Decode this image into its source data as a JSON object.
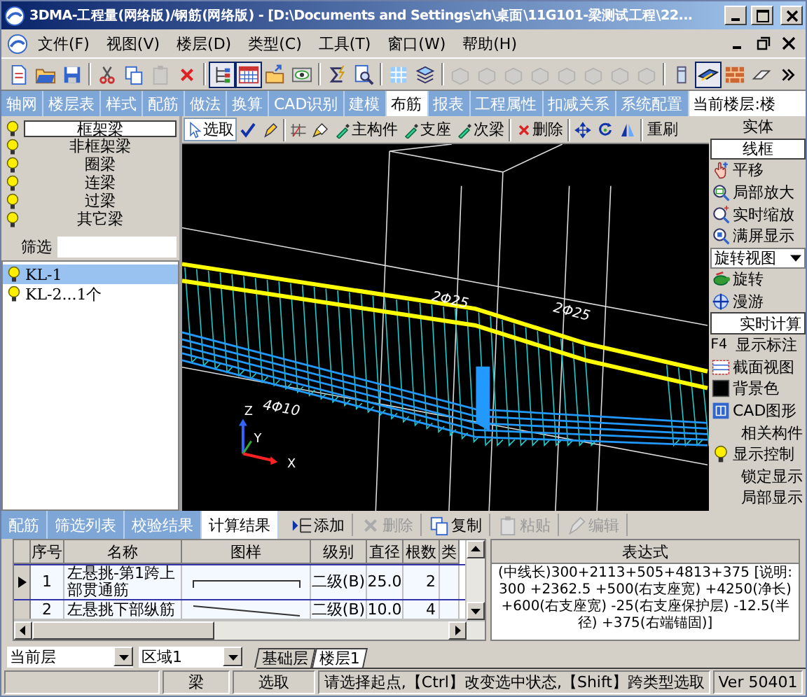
{
  "window": {
    "title": "3DMA-工程量(网络版)/钢筋(网络版) - [D:\\Documents and Settings\\zh\\桌面\\11G101-梁测试工程\\22..."
  },
  "menu": [
    "文件(F)",
    "视图(V)",
    "楼层(D)",
    "类型(C)",
    "工具(T)",
    "窗口(W)",
    "帮助(H)"
  ],
  "toolbar": [
    {
      "kind": "new",
      "disabled": false,
      "pressed": false
    },
    {
      "kind": "open",
      "disabled": false,
      "pressed": false
    },
    {
      "kind": "save",
      "disabled": false,
      "pressed": false
    },
    {
      "kind": "sep"
    },
    {
      "kind": "cut",
      "disabled": false,
      "pressed": false
    },
    {
      "kind": "copy",
      "disabled": false,
      "pressed": false
    },
    {
      "kind": "paste",
      "disabled": true,
      "pressed": false
    },
    {
      "kind": "delete",
      "disabled": false,
      "pressed": false
    },
    {
      "kind": "sep"
    },
    {
      "kind": "tree",
      "disabled": false,
      "pressed": true
    },
    {
      "kind": "table",
      "disabled": false,
      "pressed": true
    },
    {
      "kind": "export",
      "disabled": false,
      "pressed": false
    },
    {
      "kind": "view",
      "disabled": false,
      "pressed": false
    },
    {
      "kind": "sep"
    },
    {
      "kind": "sum",
      "disabled": false,
      "pressed": false
    },
    {
      "kind": "query",
      "disabled": false,
      "pressed": false
    },
    {
      "kind": "sep"
    },
    {
      "kind": "grid",
      "disabled": false,
      "pressed": false
    },
    {
      "kind": "layers",
      "disabled": false,
      "pressed": false
    },
    {
      "kind": "sep"
    },
    {
      "kind": "part",
      "disabled": true,
      "pressed": false
    },
    {
      "kind": "part",
      "disabled": true,
      "pressed": false
    },
    {
      "kind": "part",
      "disabled": true,
      "pressed": false
    },
    {
      "kind": "part",
      "disabled": true,
      "pressed": false
    },
    {
      "kind": "part",
      "disabled": true,
      "pressed": false
    },
    {
      "kind": "part",
      "disabled": true,
      "pressed": false
    },
    {
      "kind": "part",
      "disabled": true,
      "pressed": false
    },
    {
      "kind": "part",
      "disabled": true,
      "pressed": false
    },
    {
      "kind": "sep"
    },
    {
      "kind": "column",
      "disabled": false,
      "pressed": false
    },
    {
      "kind": "beam",
      "disabled": false,
      "pressed": true
    },
    {
      "kind": "brick",
      "disabled": false,
      "pressed": false
    },
    {
      "kind": "eraser",
      "disabled": false,
      "pressed": false
    },
    {
      "kind": "more",
      "disabled": false,
      "pressed": false
    }
  ],
  "module_tabs": [
    {
      "label": "轴网",
      "selected": false
    },
    {
      "label": "楼层表",
      "selected": false
    },
    {
      "label": "样式",
      "selected": false
    },
    {
      "label": "配筋",
      "selected": false
    },
    {
      "label": "做法",
      "selected": false
    },
    {
      "label": "换算",
      "selected": false
    },
    {
      "label": "CAD识别",
      "selected": false
    },
    {
      "label": "建模",
      "selected": false
    },
    {
      "label": "布筋",
      "selected": true
    },
    {
      "label": "报表",
      "selected": false
    },
    {
      "label": "工程属性",
      "selected": false
    },
    {
      "label": "扣减关系",
      "selected": false
    },
    {
      "label": "系统配置",
      "selected": false
    }
  ],
  "current_floor": "当前楼层:楼",
  "beam_types": [
    {
      "label": "框架梁",
      "selected": true
    },
    {
      "label": "非框架梁",
      "selected": false
    },
    {
      "label": "圈梁",
      "selected": false
    },
    {
      "label": "连梁",
      "selected": false
    },
    {
      "label": "过梁",
      "selected": false
    },
    {
      "label": "其它梁",
      "selected": false
    }
  ],
  "filter": {
    "label": "筛选"
  },
  "components": [
    {
      "label": "KL-1",
      "selected": true
    },
    {
      "label": "KL-2...1个",
      "selected": false
    }
  ],
  "draw_tools": [
    {
      "kind": "select",
      "label": "选取",
      "selected": true
    },
    {
      "kind": "check",
      "selected": false
    },
    {
      "kind": "pen",
      "selected": false
    },
    {
      "kind": "sep"
    },
    {
      "kind": "frame",
      "selected": false
    },
    {
      "kind": "brush",
      "selected": false
    },
    {
      "kind": "dropper",
      "label": "主构件",
      "selected": false
    },
    {
      "kind": "dropper",
      "label": "支座",
      "selected": false
    },
    {
      "kind": "dropper",
      "label": "次梁",
      "selected": false
    },
    {
      "kind": "sep"
    },
    {
      "kind": "delete",
      "label": "删除",
      "selected": false
    },
    {
      "kind": "sep"
    },
    {
      "kind": "move",
      "selected": false
    },
    {
      "kind": "rotate",
      "selected": false
    },
    {
      "kind": "mirror",
      "selected": false
    },
    {
      "kind": "sep"
    },
    {
      "kind": "plain",
      "label": "重刷",
      "selected": false
    }
  ],
  "viewport": {
    "labels": [
      "2Φ25",
      "2Φ25",
      "4Φ10"
    ],
    "axes": [
      "Z",
      "Y",
      "X"
    ]
  },
  "view_panel": [
    {
      "kind": "mode",
      "label": "实体",
      "selected": false
    },
    {
      "kind": "mode",
      "label": "线框",
      "selected": true
    },
    {
      "kind": "pan",
      "label": "平移"
    },
    {
      "kind": "zoombox",
      "label": "局部放大"
    },
    {
      "kind": "zoom",
      "label": "实时缩放"
    },
    {
      "kind": "fit",
      "label": "满屏显示"
    },
    {
      "kind": "dropdown",
      "label": "旋转视图"
    },
    {
      "kind": "rotate",
      "label": "旋转"
    },
    {
      "kind": "walk",
      "label": "漫游"
    },
    {
      "kind": "box",
      "label": "实时计算"
    },
    {
      "kind": "key",
      "key": "F4",
      "label": "显示标注"
    },
    {
      "kind": "section",
      "label": "截面视图"
    },
    {
      "kind": "bgcolor",
      "label": "背景色"
    },
    {
      "kind": "cad",
      "label": "CAD图形"
    },
    {
      "kind": "plain",
      "label": "相关构件"
    },
    {
      "kind": "bulb",
      "label": "显示控制"
    },
    {
      "kind": "plain",
      "label": "锁定显示"
    },
    {
      "kind": "plain",
      "label": "局部显示"
    }
  ],
  "bottom_tabs": [
    {
      "label": "配筋",
      "selected": false
    },
    {
      "label": "筛选列表",
      "selected": false
    },
    {
      "label": "校验结果",
      "selected": false
    },
    {
      "label": "计算结果",
      "selected": true
    }
  ],
  "grid_toolbar": [
    {
      "kind": "add",
      "label": "添加",
      "disabled": false
    },
    {
      "kind": "delete",
      "label": "删除",
      "disabled": true
    },
    {
      "kind": "copy",
      "label": "复制",
      "disabled": false
    },
    {
      "kind": "paste",
      "label": "粘贴",
      "disabled": true
    },
    {
      "kind": "edit",
      "label": "编辑",
      "disabled": true
    }
  ],
  "table": {
    "columns": [
      "序号",
      "名称",
      "图样",
      "级别",
      "直径",
      "根数",
      "类"
    ],
    "rows": [
      {
        "selected": true,
        "kind": "hook",
        "cells": [
          "1",
          "左悬挑-第1跨上部贯通筋",
          "",
          "二级(B)",
          "25.0",
          "2",
          ""
        ]
      },
      {
        "selected": false,
        "kind": "slope",
        "cells": [
          "2",
          "左悬挑下部纵筋",
          "",
          "二级(B)",
          "10.0",
          "4",
          ""
        ]
      }
    ]
  },
  "expression": {
    "title": "表达式",
    "text": "(中线长)300+2113+505+4813+375 [说明: 300 +2362.5 +500(右支座宽) +4250(净长) +600(右支座宽) -25(右支座保护层) -12.5(半径) +375(右端锚固)]"
  },
  "layer": {
    "floor": "当前层",
    "region": "区域1"
  },
  "sheet_tabs": [
    {
      "label": "基础层",
      "selected": false
    },
    {
      "label": "楼层1",
      "selected": true
    }
  ],
  "status_bar": [
    "梁",
    "选取",
    "请选择起点,【Ctrl】改变选中状态,【Shift】跨类型选取",
    "Ver 50401"
  ]
}
